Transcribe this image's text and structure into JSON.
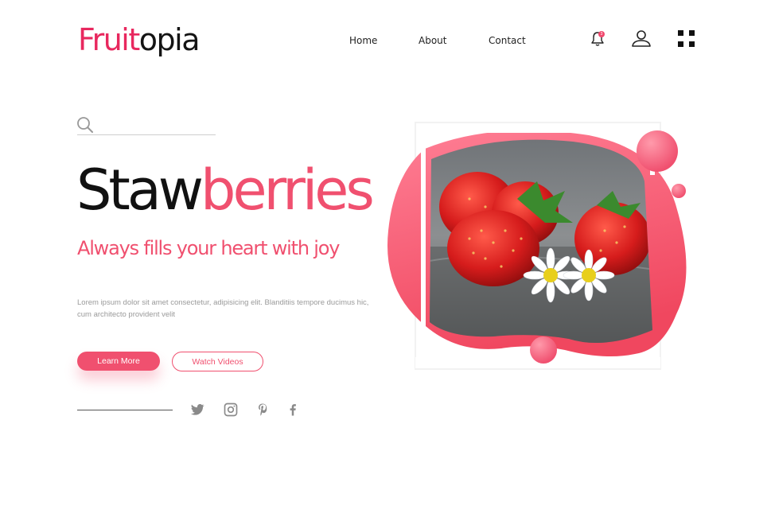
{
  "brand": {
    "part1": "Fruit",
    "part2": "opia"
  },
  "nav": {
    "home": "Home",
    "about": "About",
    "contact": "Contact"
  },
  "header_icons": {
    "notification": "bell-icon",
    "notification_badge": "3",
    "account": "user-icon",
    "menu": "grid-menu-icon"
  },
  "search": {
    "placeholder": "",
    "value": "",
    "icon": "search-icon"
  },
  "hero": {
    "title_dark": "Staw",
    "title_pink": "berries",
    "subtitle": "Always fills your heart with joy",
    "description": "Lorem ipsum dolor sit amet consectetur, adipisicing elit. Blanditiis tempore ducimus hic, cum architecto provident velit"
  },
  "buttons": {
    "primary": "Learn More",
    "secondary": "Watch Videos"
  },
  "social": [
    "twitter-icon",
    "instagram-icon",
    "pinterest-icon",
    "facebook-icon"
  ],
  "colors": {
    "accent": "#f0506f",
    "brand": "#e8285e",
    "text": "#111111",
    "muted": "#9a9a9a"
  }
}
